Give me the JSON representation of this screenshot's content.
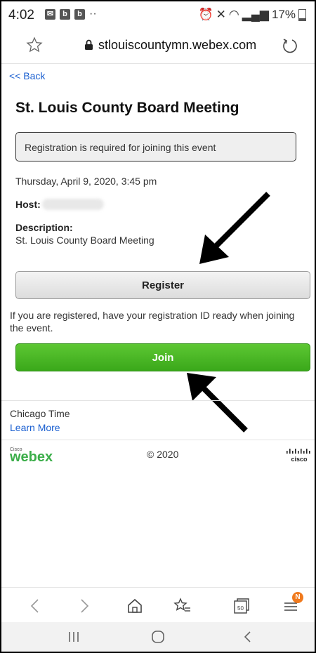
{
  "status_bar": {
    "time": "4:02",
    "battery": "17%",
    "notif_icons": [
      "mail-icon",
      "b-app-icon",
      "b-app-icon"
    ],
    "b_letter": "b",
    "more": "··"
  },
  "browser": {
    "url": "stlouiscountymn.webex.com"
  },
  "page": {
    "back_link": "<< Back",
    "title": "St. Louis County Board Meeting",
    "notice": "Registration is required for joining this event",
    "datetime": "Thursday, April 9, 2020, 3:45 pm",
    "host_label": "Host:",
    "description_label": "Description:",
    "description_text": "St. Louis County Board Meeting",
    "register_label": "Register",
    "registered_note": "If you are registered, have your registration ID ready when joining the event.",
    "join_label": "Join"
  },
  "footer": {
    "timezone": "Chicago Time",
    "learn_more": "Learn More",
    "copyright": "© 2020",
    "webex_small": "Cisco",
    "webex_logo": "webex",
    "cisco_logo": "cisco"
  },
  "bottom_nav": {
    "tabs_count": "50",
    "badge": "N"
  },
  "colors": {
    "link": "#1a5fd0",
    "join_green": "#3aa81a",
    "badge_orange": "#f07a1e"
  }
}
